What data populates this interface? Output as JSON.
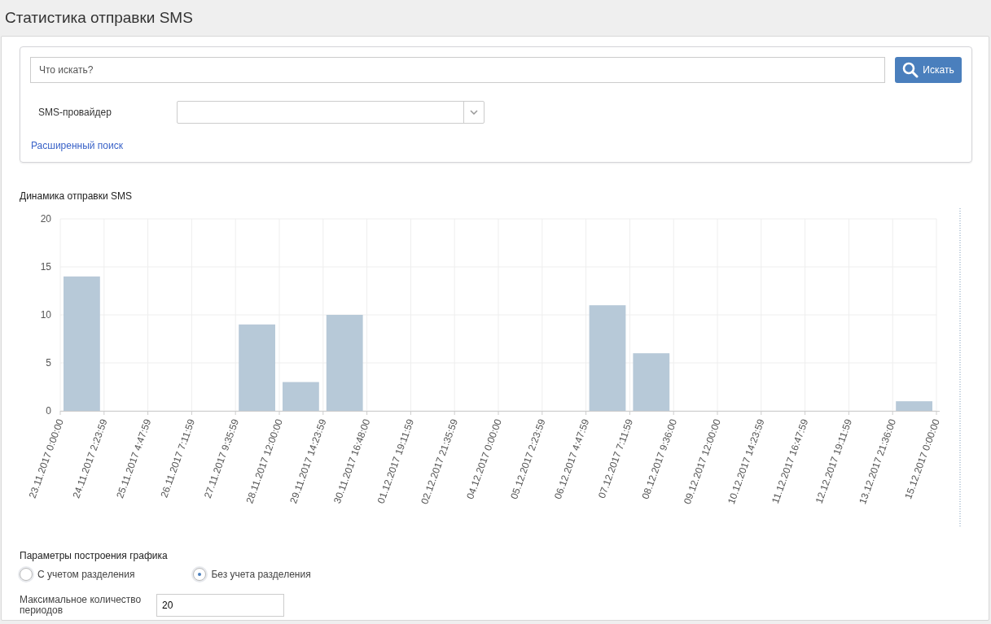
{
  "page_title": "Статистика отправки SMS",
  "search": {
    "placeholder": "Что искать?",
    "button": "Искать",
    "provider_label": "SMS-провайдер",
    "advanced_link": "Расширенный поиск"
  },
  "chart_title": "Динамика отправки SMS",
  "chart_data": {
    "type": "bar",
    "yticks": [
      0,
      5,
      10,
      15,
      20
    ],
    "ylim": [
      0,
      20
    ],
    "grid": true,
    "categories": [
      "23.11.2017 0:00:00",
      "24.11.2017 2:23:59",
      "25.11.2017 4:47:59",
      "26.11.2017 7:11:59",
      "27.11.2017 9:35:59",
      "28.11.2017 12:00:00",
      "29.11.2017 14:23:59",
      "30.11.2017 16:48:00",
      "01.12.2017 19:11:59",
      "02.12.2017 21:35:59",
      "04.12.2017 0:00:00",
      "05.12.2017 2:23:59",
      "06.12.2017 4:47:59",
      "07.12.2017 7:11:59",
      "08.12.2017 9:36:00",
      "09.12.2017 12:00:00",
      "10.12.2017 14:23:59",
      "11.12.2017 16:47:59",
      "12.12.2017 19:11:59",
      "13.12.2017 21:36:00",
      "15.12.2017 0:00:00"
    ],
    "series": [
      {
        "color": "#b7c9d8",
        "values": [
          14,
          0,
          0,
          0,
          9,
          3,
          10,
          0,
          0,
          0,
          0,
          0,
          11,
          6,
          0,
          0,
          0,
          0,
          0,
          1,
          null
        ]
      }
    ]
  },
  "params": {
    "title": "Параметры построения графика",
    "options": [
      {
        "label": "С учетом разделения",
        "selected": false
      },
      {
        "label": "Без учета разделения",
        "selected": true
      }
    ],
    "max_periods_label": "Максимальное количество периодов",
    "max_periods_value": "20"
  }
}
